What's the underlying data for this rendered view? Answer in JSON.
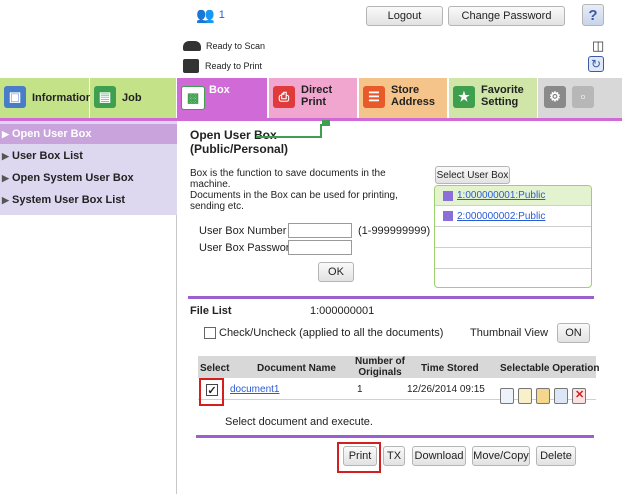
{
  "header": {
    "user_count": "1",
    "logout_label": "Logout",
    "change_password_label": "Change Password",
    "help_label": "?",
    "scan_status": "Ready to Scan",
    "print_status": "Ready to Print"
  },
  "tabs": {
    "information": "Information",
    "job": "Job",
    "box": "Box",
    "direct_print": "Direct Print",
    "store_address": "Store\nAddress",
    "favorite_setting": "Favorite\nSetting"
  },
  "sidebar": {
    "items": [
      {
        "label": "Open User Box"
      },
      {
        "label": "User Box List"
      },
      {
        "label": "Open System User Box"
      },
      {
        "label": "System User Box List"
      }
    ]
  },
  "main": {
    "title": "Open User Box\n(Public/Personal)",
    "desc1": "Box is the function to save documents in the machine.",
    "desc2": "Documents in the Box can be used for printing, sending etc.",
    "box_number_label": "User Box Number",
    "box_number_range": "(1-999999999)",
    "box_password_label": "User Box Password",
    "ok_label": "OK",
    "select_user_box_label": "Select User Box",
    "user_boxes": [
      "1:000000001:Public",
      "2:000000002:Public"
    ]
  },
  "file_list": {
    "label": "File List",
    "box_id": "1:000000001",
    "check_all_label": "Check/Uncheck (applied to all the documents)",
    "thumbnail_label": "Thumbnail View",
    "thumbnail_toggle": "ON",
    "columns": [
      "Select",
      "Document Name",
      "Number of Originals",
      "Time Stored",
      "Selectable Operation"
    ],
    "rows": [
      {
        "name": "document1",
        "originals": "1",
        "time": "12/26/2014 09:15",
        "checked": true
      }
    ],
    "hint": "Select document and execute."
  },
  "actions": {
    "print": "Print",
    "tx": "TX",
    "download": "Download",
    "move_copy": "Move/Copy",
    "delete": "Delete"
  },
  "colors": {
    "sidebar_active": "#c9a4dc",
    "sidebar_bg": "#ddd8f0",
    "box_tab_bg": "#cf6ad6",
    "info_tab_bg": "#c4e287",
    "divider_purple": "#9c5fcf",
    "highlight_red": "#d21f1f"
  }
}
